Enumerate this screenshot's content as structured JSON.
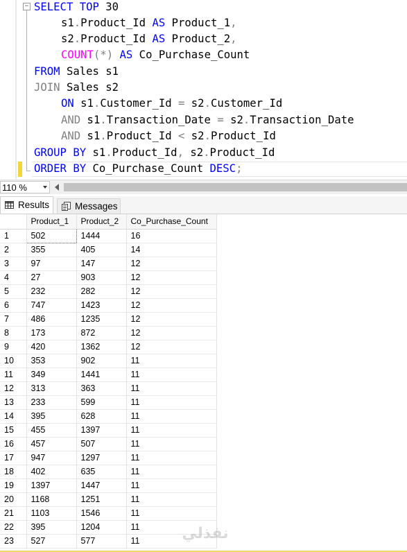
{
  "editor": {
    "collapse_symbol": "−",
    "lines": [
      [
        "SELECT",
        " ",
        "TOP",
        " 30"
      ],
      [
        "s1",
        ".",
        "Product_Id",
        " ",
        "AS",
        " Product_1",
        ","
      ],
      [
        "s2",
        ".",
        "Product_Id",
        " ",
        "AS",
        " Product_2",
        ","
      ],
      [
        "COUNT",
        "(*)",
        " ",
        "AS",
        " Co_Purchase_Count"
      ],
      [
        "FROM",
        " Sales s1"
      ],
      [
        "JOIN",
        " Sales s2"
      ],
      [
        "ON",
        " s1",
        ".",
        "Customer_Id ",
        "=",
        " s2",
        ".",
        "Customer_Id"
      ],
      [
        "AND",
        " s1",
        ".",
        "Transaction_Date ",
        "=",
        " s2",
        ".",
        "Transaction_Date"
      ],
      [
        "AND",
        " s1",
        ".",
        "Product_Id ",
        "<",
        " s2",
        ".",
        "Product_Id"
      ],
      [
        "GROUP",
        " ",
        "BY",
        " s1",
        ".",
        "Product_Id",
        ",",
        " s2",
        ".",
        "Product_Id"
      ],
      [
        "ORDER",
        " ",
        "BY",
        " Co_Purchase_Count ",
        "DESC",
        ";"
      ]
    ]
  },
  "zoom": {
    "level": "110 %"
  },
  "tabs": {
    "results_label": "Results",
    "messages_label": "Messages"
  },
  "grid": {
    "columns": [
      "Product_1",
      "Product_2",
      "Co_Purchase_Count"
    ],
    "rows": [
      [
        "1",
        "502",
        "1444",
        "16"
      ],
      [
        "2",
        "355",
        "405",
        "14"
      ],
      [
        "3",
        "97",
        "147",
        "12"
      ],
      [
        "4",
        "27",
        "903",
        "12"
      ],
      [
        "5",
        "232",
        "282",
        "12"
      ],
      [
        "6",
        "747",
        "1423",
        "12"
      ],
      [
        "7",
        "486",
        "1235",
        "12"
      ],
      [
        "8",
        "173",
        "872",
        "12"
      ],
      [
        "9",
        "420",
        "1362",
        "12"
      ],
      [
        "10",
        "353",
        "902",
        "11"
      ],
      [
        "11",
        "349",
        "1441",
        "11"
      ],
      [
        "12",
        "313",
        "363",
        "11"
      ],
      [
        "13",
        "233",
        "599",
        "11"
      ],
      [
        "14",
        "395",
        "628",
        "11"
      ],
      [
        "15",
        "455",
        "1397",
        "11"
      ],
      [
        "16",
        "457",
        "507",
        "11"
      ],
      [
        "17",
        "947",
        "1297",
        "11"
      ],
      [
        "18",
        "402",
        "635",
        "11"
      ],
      [
        "19",
        "1397",
        "1447",
        "11"
      ],
      [
        "20",
        "1168",
        "1251",
        "11"
      ],
      [
        "21",
        "1103",
        "1546",
        "11"
      ],
      [
        "22",
        "395",
        "1204",
        "11"
      ],
      [
        "23",
        "527",
        "577",
        "11"
      ]
    ]
  },
  "watermark": {
    "text": "نفذلي"
  },
  "colors": {
    "keyword": "#0000ff",
    "operator": "#808080",
    "function": "#ff00ff",
    "change_marker": "#f4d33c"
  }
}
